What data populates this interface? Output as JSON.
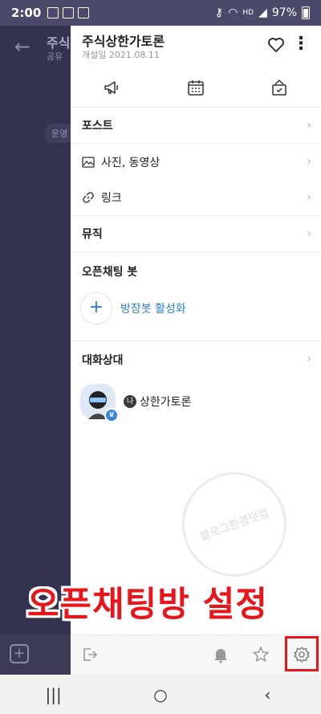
{
  "status_bar": {
    "time": "2:00",
    "hd": "HD",
    "battery": "97%"
  },
  "background_chat": {
    "title": "주식",
    "subtitle": "공유",
    "pill": "운영"
  },
  "drawer": {
    "title": "주식상한가토론",
    "open_date": "개설일 2021.08.11",
    "menu": {
      "post": "포스트",
      "photos": "사진, 동영상",
      "links": "링크",
      "music": "뮤직"
    },
    "openbot": {
      "title": "오픈채팅 봇",
      "add_label": "방장봇 활성화"
    },
    "members": {
      "title": "대화상대",
      "me_badge": "나",
      "list": [
        {
          "name": "상한가토론"
        }
      ]
    }
  },
  "watermark": {
    "text": "블로그한경덧컴"
  },
  "caption": "오픈채팅방 설정",
  "icons": {
    "heart": "heart-icon",
    "more": "more-vertical-icon",
    "notice": "megaphone-icon",
    "calendar": "calendar-icon",
    "vote": "ballot-box-icon",
    "exit": "exit-icon",
    "bell": "bell-icon",
    "star": "star-icon",
    "settings": "gear-icon"
  }
}
